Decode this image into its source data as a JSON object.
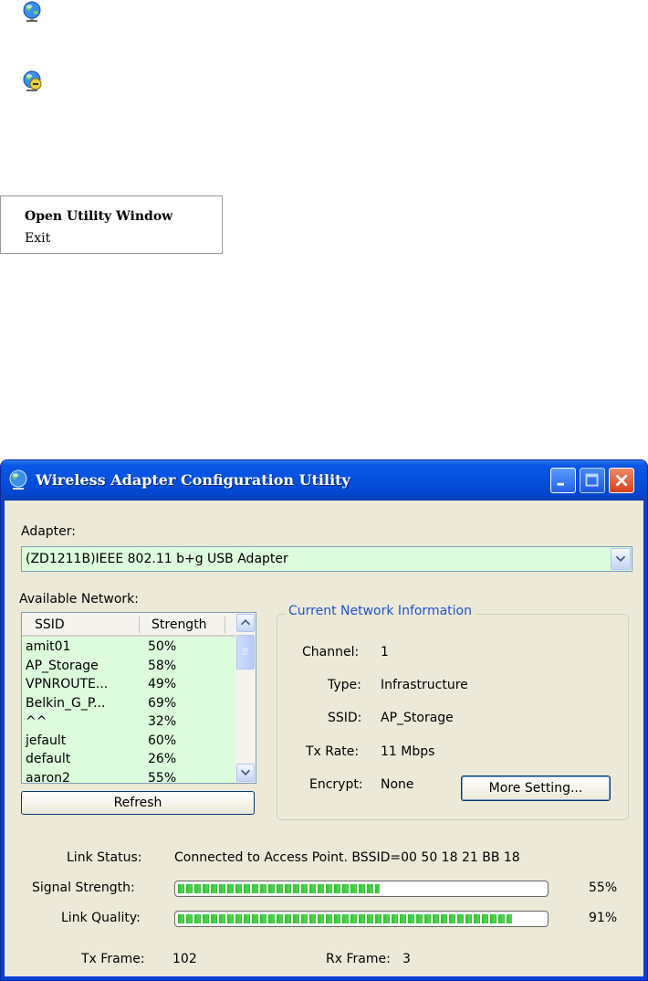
{
  "tray": {
    "icons": [
      "globe-tray-icon",
      "globe-disconnected-tray-icon"
    ]
  },
  "context_menu": {
    "items": [
      "Open Utility Window",
      "Exit"
    ]
  },
  "window": {
    "title": "Wireless Adapter Configuration Utility",
    "adapter_label": "Adapter:",
    "adapter_value": "(ZD1211B)IEEE 802.11 b+g USB Adapter",
    "available_label": "Available Network:",
    "columns": [
      "SSID",
      "Strength"
    ],
    "networks": [
      {
        "ssid": "amit01",
        "strength": "50%"
      },
      {
        "ssid": "AP_Storage",
        "strength": "58%"
      },
      {
        "ssid": "VPNROUTE...",
        "strength": "49%"
      },
      {
        "ssid": "Belkin_G_P...",
        "strength": "69%"
      },
      {
        "ssid": "^^",
        "strength": "32%"
      },
      {
        "ssid": "jefault",
        "strength": "60%"
      },
      {
        "ssid": "default",
        "strength": "26%"
      },
      {
        "ssid": "aaron2",
        "strength": "55%"
      }
    ],
    "refresh_label": "Refresh",
    "current_info": {
      "title": "Current Network Information",
      "channel_label": "Channel:",
      "channel_value": "1",
      "type_label": "Type:",
      "type_value": "Infrastructure",
      "ssid_label": "SSID:",
      "ssid_value": "AP_Storage",
      "txrate_label": "Tx Rate:",
      "txrate_value": "11 Mbps",
      "encrypt_label": "Encrypt:",
      "encrypt_value": "None",
      "more_setting_label": "More Setting..."
    },
    "link_status_label": "Link Status:",
    "link_status_value": "Connected to Access Point. BSSID=00 50 18 21 BB 18",
    "signal_label": "Signal Strength:",
    "signal_value": "55%",
    "signal_fraction": 0.55,
    "quality_label": "Link Quality:",
    "quality_value": "91%",
    "quality_fraction": 0.91,
    "tx_frame_label": "Tx Frame:",
    "tx_frame_value": "102",
    "rx_frame_label": "Rx Frame:",
    "rx_frame_value": "3"
  },
  "colors": {
    "titlebar": "#0550df",
    "client_bg": "#ece9d8",
    "list_bg": "#ddfbdd",
    "group_title": "#2152d6",
    "progress": "#2fbf2f"
  }
}
